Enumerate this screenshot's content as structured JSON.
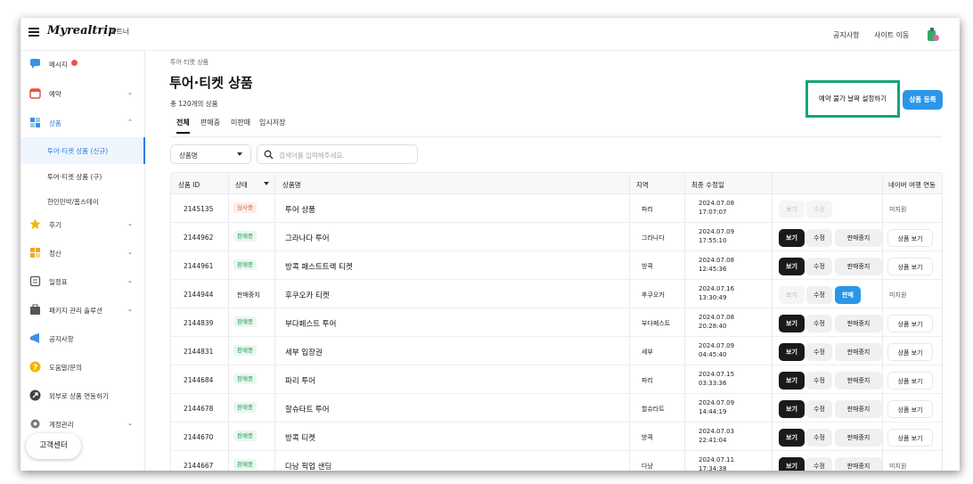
{
  "topbar": {
    "brand": "Myrealtrip",
    "partner": "파트너",
    "notice": "공지사항",
    "site_move": "사이트 이동"
  },
  "sidebar": {
    "items": [
      {
        "label": "메시지",
        "icon": "message-icon",
        "badge": true
      },
      {
        "label": "예약",
        "icon": "calendar-icon",
        "chevron": "down"
      },
      {
        "label": "상품",
        "icon": "product-icon",
        "chevron": "up",
        "active": true
      },
      {
        "label": "후기",
        "icon": "star-icon",
        "chevron": "down"
      },
      {
        "label": "정산",
        "icon": "settlement-icon",
        "chevron": "down"
      },
      {
        "label": "일정표",
        "icon": "schedule-icon",
        "chevron": "down"
      },
      {
        "label": "패키지 관리 솔루션",
        "icon": "package-icon",
        "chevron": "down"
      },
      {
        "label": "공지사항",
        "icon": "megaphone-icon"
      },
      {
        "label": "도움말/문의",
        "icon": "help-icon"
      },
      {
        "label": "외부로 상품 연동하기",
        "icon": "link-out-icon"
      },
      {
        "label": "계정관리",
        "icon": "gear-icon",
        "chevron": "down"
      }
    ],
    "subitems": [
      {
        "label": "투어·티켓 상품 (신규)",
        "active": true
      },
      {
        "label": "투어·티켓 상품 (구)"
      },
      {
        "label": "한인민박/홈스테이"
      }
    ],
    "help_button": "고객센터"
  },
  "main": {
    "breadcrumb": "투어·티켓 상품",
    "title": "투어·티켓 상품",
    "count": "총 120개의 상품",
    "tabs": [
      "전체",
      "판매중",
      "미판매",
      "임시저장"
    ],
    "unavailable_btn": "예약 불가 날짜 설정하기",
    "register_btn": "상품 등록",
    "filter_select": "상품명",
    "search_placeholder": "검색어를 입력해주세요."
  },
  "table": {
    "headers": {
      "id": "상품 ID",
      "status": "상태",
      "name": "상품명",
      "region": "지역",
      "updated": "최종 수정일",
      "naver": "네이버 여행 연동"
    },
    "buttons": {
      "view": "보기",
      "edit": "수정",
      "stop": "판매중지",
      "sell": "판매",
      "product_view": "상품 보기"
    },
    "rows": [
      {
        "id": "2145135",
        "status": "심사중",
        "name": "투어 상품",
        "region": "파리",
        "date": "2024.07.08",
        "time": "17:07:07",
        "actions": "disabled",
        "naver": "미지원"
      },
      {
        "id": "2144962",
        "status": "판매중",
        "name": "그라나다 투어",
        "region": "그라나다",
        "date": "2024.07.09",
        "time": "17:55:10",
        "actions": "selling",
        "naver": "상품 보기"
      },
      {
        "id": "2144961",
        "status": "판매중",
        "name": "방콕 패스트트랙 티켓",
        "region": "방콕",
        "date": "2024.07.08",
        "time": "12:45:36",
        "actions": "selling",
        "naver": "상품 보기"
      },
      {
        "id": "2144944",
        "status": "판매중지",
        "name": "후쿠오카 티켓",
        "region": "후쿠오카",
        "date": "2024.07.16",
        "time": "13:30:49",
        "actions": "stopped",
        "naver": "미지원"
      },
      {
        "id": "2144839",
        "status": "판매중",
        "name": "부다페스트 투어",
        "region": "부다페스트",
        "date": "2024.07.08",
        "time": "20:28:40",
        "actions": "selling",
        "naver": "상품 보기"
      },
      {
        "id": "2144831",
        "status": "판매중",
        "name": "세부 입장권",
        "region": "세부",
        "date": "2024.07.09",
        "time": "04:45:40",
        "actions": "selling",
        "naver": "상품 보기"
      },
      {
        "id": "2144684",
        "status": "판매중",
        "name": "파리 투어",
        "region": "파리",
        "date": "2024.07.15",
        "time": "03:33:36",
        "actions": "selling",
        "naver": "상품 보기"
      },
      {
        "id": "2144678",
        "status": "판매중",
        "name": "할슈타트 투어",
        "region": "할슈타트",
        "date": "2024.07.09",
        "time": "14:44:19",
        "actions": "selling",
        "naver": "상품 보기"
      },
      {
        "id": "2144670",
        "status": "판매중",
        "name": "방콕 티켓",
        "region": "방콕",
        "date": "2024.07.03",
        "time": "22:41:04",
        "actions": "selling",
        "naver": "상품 보기"
      },
      {
        "id": "2144667",
        "status": "판매중",
        "name": "다낭 픽업 샌딩",
        "region": "다낭",
        "date": "2024.07.11",
        "time": "17:34:38",
        "actions": "selling",
        "naver": "미지원"
      }
    ]
  },
  "colors": {
    "accent": "#2b96e8",
    "highlight_border": "#14a67a",
    "selling_badge": "#1f9a58",
    "review_badge": "#e0603b"
  }
}
